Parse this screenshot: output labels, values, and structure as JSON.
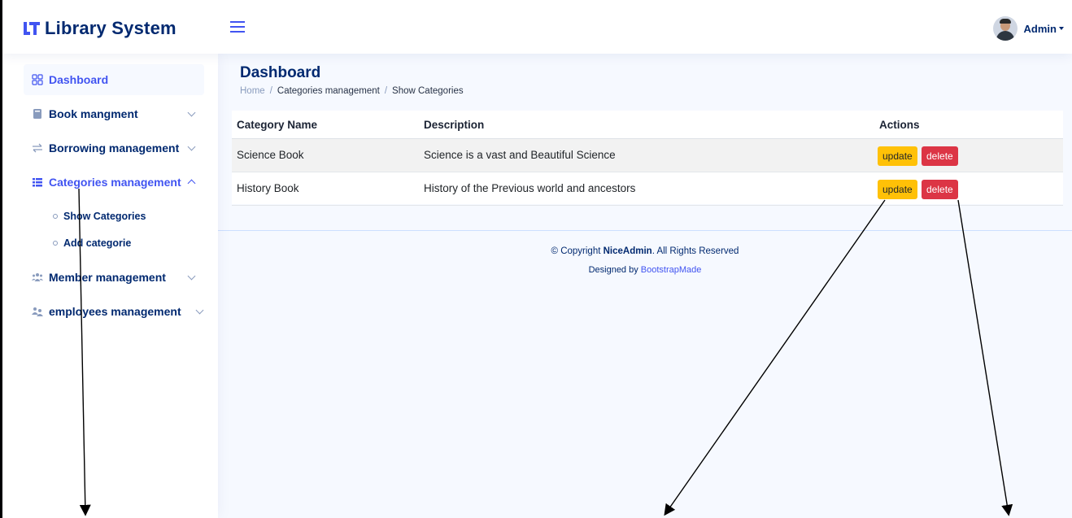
{
  "app": {
    "title": "Library System"
  },
  "header": {
    "user_name": "Admin"
  },
  "sidebar": {
    "items": [
      {
        "label": "Dashboard",
        "icon": "grid-icon"
      },
      {
        "label": "Book mangment",
        "icon": "book-icon"
      },
      {
        "label": "Borrowing management",
        "icon": "arrows-icon"
      },
      {
        "label": "Categories management",
        "icon": "list-icon"
      },
      {
        "label": "Member management",
        "icon": "people-icon"
      },
      {
        "label": "employees management",
        "icon": "people-icon"
      }
    ],
    "subitems": [
      {
        "label": "Show Categories"
      },
      {
        "label": "Add categorie"
      }
    ]
  },
  "main": {
    "title": "Dashboard",
    "breadcrumb": [
      "Home",
      "Categories management",
      "Show Categories"
    ]
  },
  "table": {
    "headers": [
      "Category Name",
      "Description",
      "Actions"
    ],
    "rows": [
      {
        "name": "Science Book",
        "description": "Science is a vast and Beautiful Science"
      },
      {
        "name": "History Book",
        "description": "History of the Previous world and ancestors"
      }
    ],
    "update_label": "update",
    "delete_label": "delete"
  },
  "footer": {
    "copyright_prefix": "© Copyright",
    "brand": "NiceAdmin",
    "copyright_suffix": ". All Rights Reserved",
    "designed_by": "Designed by",
    "designer": "BootstrapMade"
  },
  "colors": {
    "primary": "#4154f1",
    "navy": "#012970",
    "update": "#ffc107",
    "delete": "#dc3545",
    "background": "#f6f9ff"
  }
}
